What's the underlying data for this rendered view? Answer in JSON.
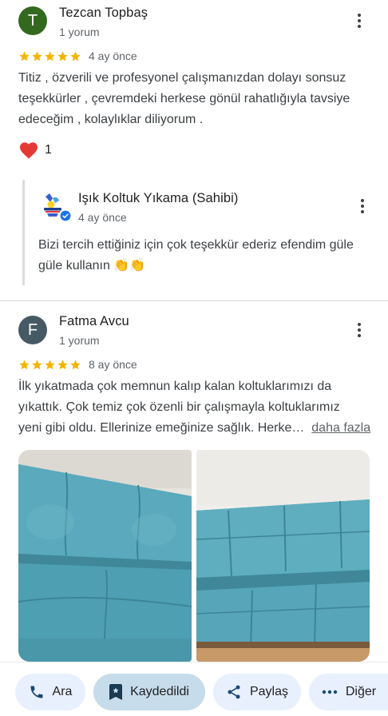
{
  "reviews": [
    {
      "avatar_letter": "T",
      "avatar_color": "#33691e",
      "name": "Tezcan Topbaş",
      "meta": "1 yorum",
      "rating": 5,
      "age": "4 ay önce",
      "lines": [
        "Titiz , özverili ve profesyonel  çalışmanızdan dolayı sonsuz",
        "teşekkürler , çevremdeki herkese gönül rahatlığıyla tavsiye",
        "edeceğim , kolaylıklar diliyorum ."
      ],
      "reaction_count": "1",
      "reply": {
        "owner_name": "Işık Koltuk Yıkama (Sahibi)",
        "age": "4 ay önce",
        "lines": [
          "Bizi tercih ettiğiniz için çok teşekkür ederiz efendim güle",
          "güle kullanın 👏👏"
        ]
      }
    },
    {
      "avatar_letter": "F",
      "avatar_color": "#455a64",
      "name": "Fatma Avcu",
      "meta": "1 yorum",
      "rating": 5,
      "age": "8 ay önce",
      "lines": [
        "İlk yıkatmada çok memnun kalıp kalan koltuklarımızı da",
        "yıkattık. Çok temiz çok özenli bir çalışmayla koltuklarımız",
        "yeni gibi oldu. Ellerinize emeğinize sağlık. Herke…"
      ],
      "more_label": "daha fazla"
    }
  ],
  "colors": {
    "star": "#f4b400",
    "heart": "#e53935",
    "sofa": "#5fa8ba",
    "verified": "#1a73e8"
  },
  "bottom_bar": {
    "call": "Ara",
    "saved": "Kaydedildi",
    "share": "Paylaş",
    "more": "Diğer"
  }
}
